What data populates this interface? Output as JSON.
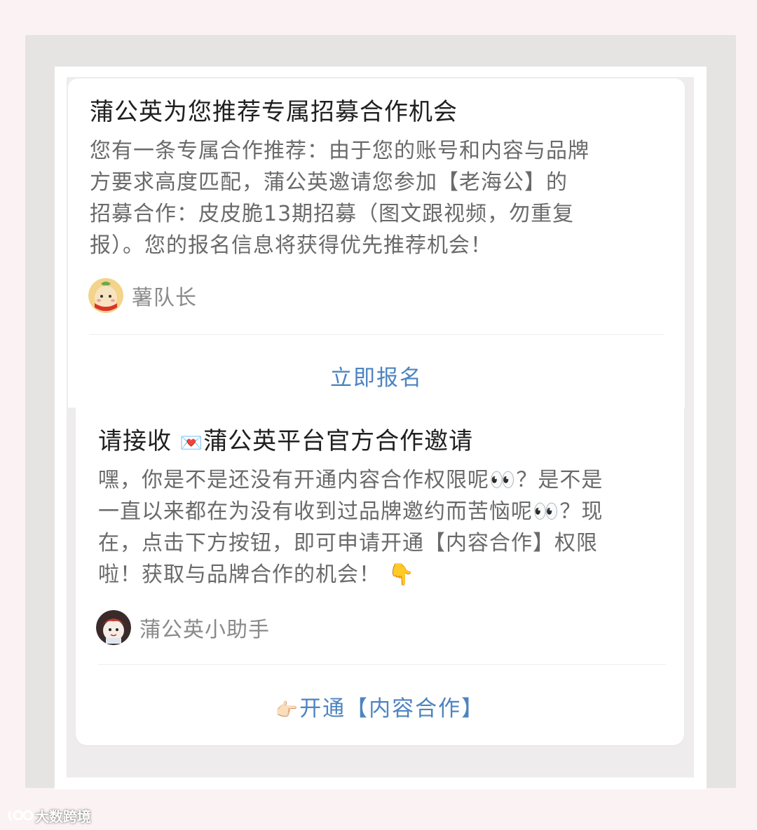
{
  "card1": {
    "title": "蒲公英为您推荐专属招募合作机会",
    "body_lines": [
      "您有一条专属合作推荐：由于您的账号和内容与品牌",
      "方要求高度匹配，蒲公英邀请您参加【老海公】的",
      "招募合作：皮皮脆13期招募（图文跟视频，勿重复",
      "报）。您的报名信息将获得优先推荐机会！"
    ],
    "sender": "薯队长",
    "action": "立即报名"
  },
  "card2": {
    "title_prefix": "请接收 ",
    "title_emoji": "💌",
    "title_suffix": "蒲公英平台官方合作邀请",
    "body_lines": [
      "嘿，你是不是还没有开通内容合作权限呢👀？是不是",
      "一直以来都在为没有收到过品牌邀约而苦恼呢👀？现",
      "在，点击下方按钮，即可申请开通【内容合作】权限",
      "啦！获取与品牌合作的机会！ 👇"
    ],
    "sender": "蒲公英小助手",
    "action_emoji": "👉🏻",
    "action": "开通【内容合作】"
  },
  "watermark": "大数跨境",
  "colors": {
    "link": "#4d84c0",
    "title": "#1f1f1f",
    "body": "#6a6a6a"
  }
}
